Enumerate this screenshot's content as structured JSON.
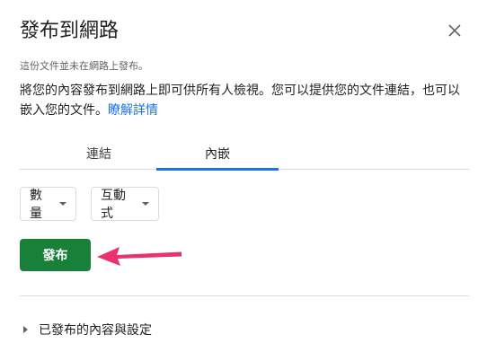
{
  "dialog": {
    "title": "發布到網路",
    "close_icon": "close-icon",
    "note": "這份文件並未在網路上發布。",
    "description": "將您的內容發布到網路上即可供所有人檢視。您可以提供您的文件連結，也可以嵌入您的文件。",
    "learn_more": "瞭解詳情",
    "link_color": "#1a73e8"
  },
  "tabs": [
    {
      "label": "連結",
      "selected": false
    },
    {
      "label": "內嵌",
      "selected": true
    }
  ],
  "options": {
    "size": {
      "value": "數量"
    },
    "mode": {
      "value": "互動式"
    }
  },
  "publish_button": {
    "label": "發布",
    "color": "#188038"
  },
  "annotation": {
    "icon": "pointer-arrow-icon",
    "color": "#e8336e"
  },
  "published_settings": {
    "label": "已發布的內容與設定",
    "expanded": false
  }
}
